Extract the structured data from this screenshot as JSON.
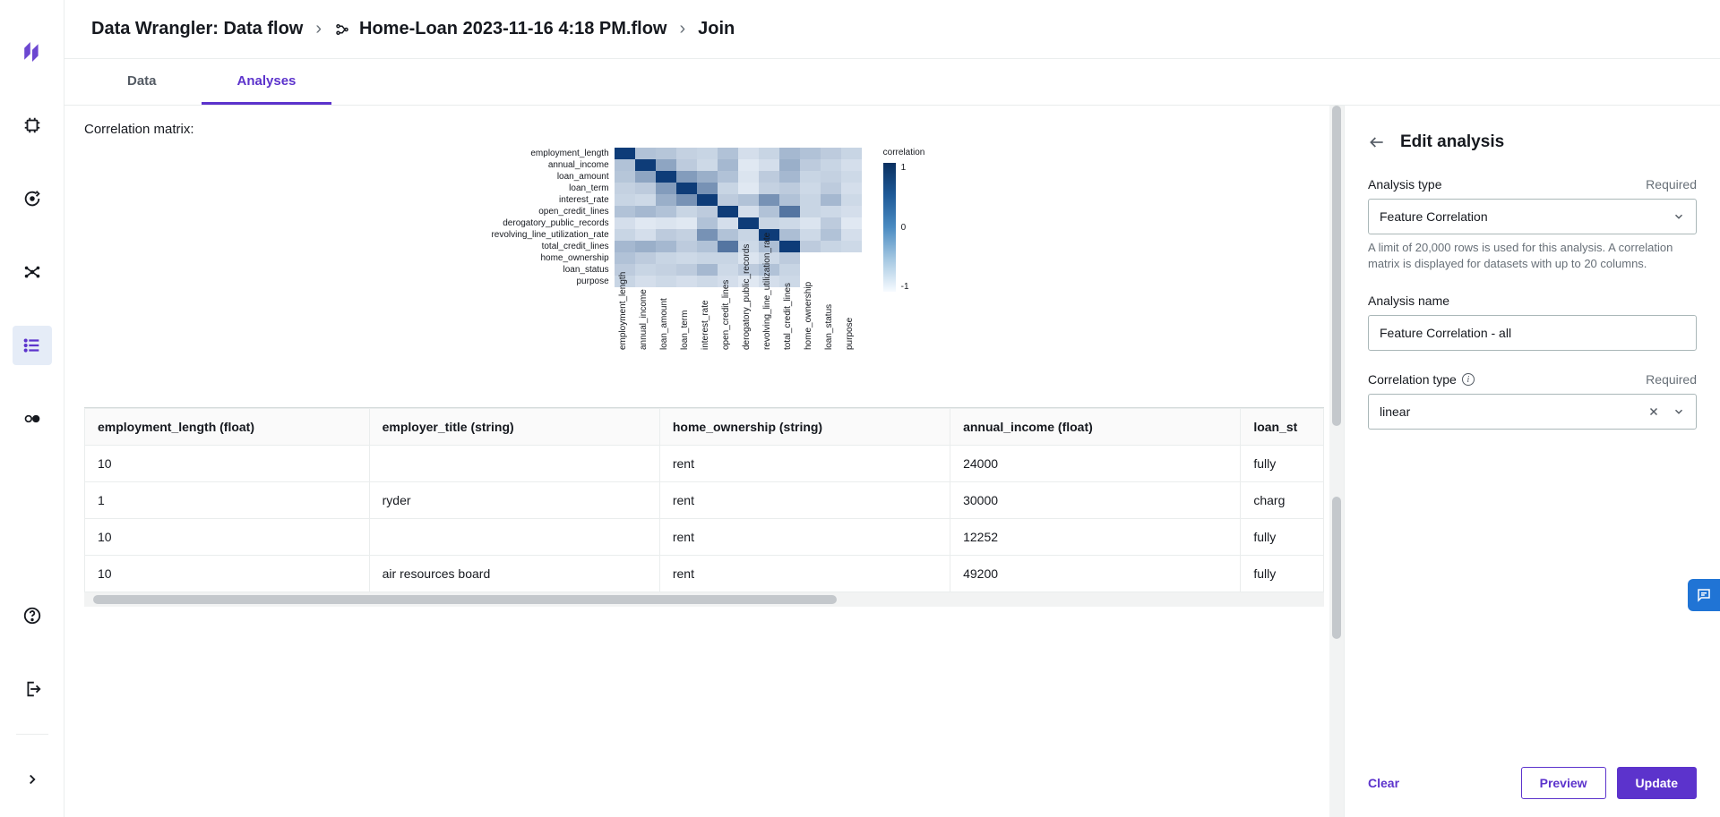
{
  "breadcrumb": {
    "root": "Data Wrangler: Data flow",
    "file": "Home-Loan 2023-11-16 4:18 PM.flow",
    "node": "Join"
  },
  "tabs": {
    "data": "Data",
    "analyses": "Analyses"
  },
  "section_title": "Correlation matrix:",
  "chart_data": {
    "type": "heatmap",
    "title": "correlation",
    "colorbar_ticks": [
      "1",
      "0",
      "-1"
    ],
    "labels": [
      "employment_length",
      "annual_income",
      "loan_amount",
      "loan_term",
      "interest_rate",
      "open_credit_lines",
      "derogatory_public_records",
      "revolving_line_utilization_rate",
      "total_credit_lines",
      "home_ownership",
      "loan_status",
      "purpose"
    ],
    "matrix": [
      [
        1.0,
        0.3,
        0.28,
        0.22,
        0.2,
        0.3,
        0.15,
        0.2,
        0.35,
        0.3,
        0.25,
        0.2
      ],
      [
        0.3,
        1.0,
        0.45,
        0.25,
        0.18,
        0.35,
        0.1,
        0.15,
        0.4,
        0.25,
        0.2,
        0.15
      ],
      [
        0.28,
        0.45,
        1.0,
        0.5,
        0.4,
        0.3,
        0.12,
        0.25,
        0.35,
        0.2,
        0.22,
        0.18
      ],
      [
        0.22,
        0.25,
        0.5,
        1.0,
        0.55,
        0.2,
        0.1,
        0.22,
        0.25,
        0.18,
        0.25,
        0.15
      ],
      [
        0.2,
        0.18,
        0.4,
        0.55,
        1.0,
        0.25,
        0.3,
        0.55,
        0.3,
        0.2,
        0.35,
        0.18
      ],
      [
        0.3,
        0.35,
        0.3,
        0.2,
        0.25,
        1.0,
        0.15,
        0.3,
        0.7,
        0.2,
        0.18,
        0.15
      ],
      [
        0.15,
        0.1,
        0.12,
        0.1,
        0.3,
        0.15,
        1.0,
        0.2,
        0.18,
        0.12,
        0.25,
        0.1
      ],
      [
        0.2,
        0.15,
        0.25,
        0.22,
        0.55,
        0.3,
        0.2,
        1.0,
        0.32,
        0.18,
        0.3,
        0.15
      ],
      [
        0.35,
        0.4,
        0.35,
        0.25,
        0.3,
        0.7,
        0.18,
        0.32,
        1.0,
        0.25,
        0.2,
        0.18
      ],
      [
        0.3,
        0.25,
        0.2,
        0.18,
        0.2,
        0.2,
        0.12,
        0.18,
        0.25,
        null,
        null,
        null
      ],
      [
        0.25,
        0.2,
        0.22,
        0.25,
        0.35,
        0.18,
        0.25,
        0.3,
        0.2,
        null,
        null,
        null
      ],
      [
        0.2,
        0.15,
        0.18,
        0.15,
        0.18,
        0.15,
        0.1,
        0.15,
        0.18,
        null,
        null,
        null
      ]
    ]
  },
  "table": {
    "headers": [
      "employment_length (float)",
      "employer_title (string)",
      "home_ownership (string)",
      "annual_income (float)",
      "loan_st"
    ],
    "rows": [
      [
        "10",
        "",
        "rent",
        "24000",
        "fully"
      ],
      [
        "1",
        "ryder",
        "rent",
        "30000",
        "charg"
      ],
      [
        "10",
        "",
        "rent",
        "12252",
        "fully"
      ],
      [
        "10",
        "air resources board",
        "rent",
        "49200",
        "fully"
      ]
    ]
  },
  "panel": {
    "title": "Edit analysis",
    "type_label": "Analysis type",
    "required": "Required",
    "type_value": "Feature Correlation",
    "type_help": "A limit of 20,000 rows is used for this analysis. A correlation matrix is displayed for datasets with up to 20 columns.",
    "name_label": "Analysis name",
    "name_value": "Feature Correlation - all",
    "corr_label": "Correlation type",
    "corr_value": "linear",
    "clear": "Clear",
    "preview": "Preview",
    "update": "Update"
  }
}
